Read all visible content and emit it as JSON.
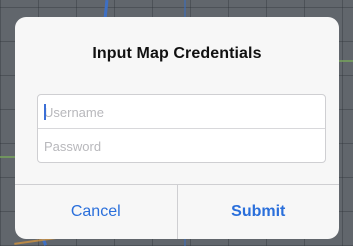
{
  "dialog": {
    "title": "Input Map Credentials",
    "username": {
      "placeholder": "Username",
      "value": ""
    },
    "password": {
      "placeholder": "Password",
      "value": ""
    },
    "cancel_label": "Cancel",
    "submit_label": "Submit"
  },
  "colors": {
    "accent": "#2a6fdb",
    "dialog_background": "#f7f7f7",
    "backdrop": "#61666c"
  }
}
